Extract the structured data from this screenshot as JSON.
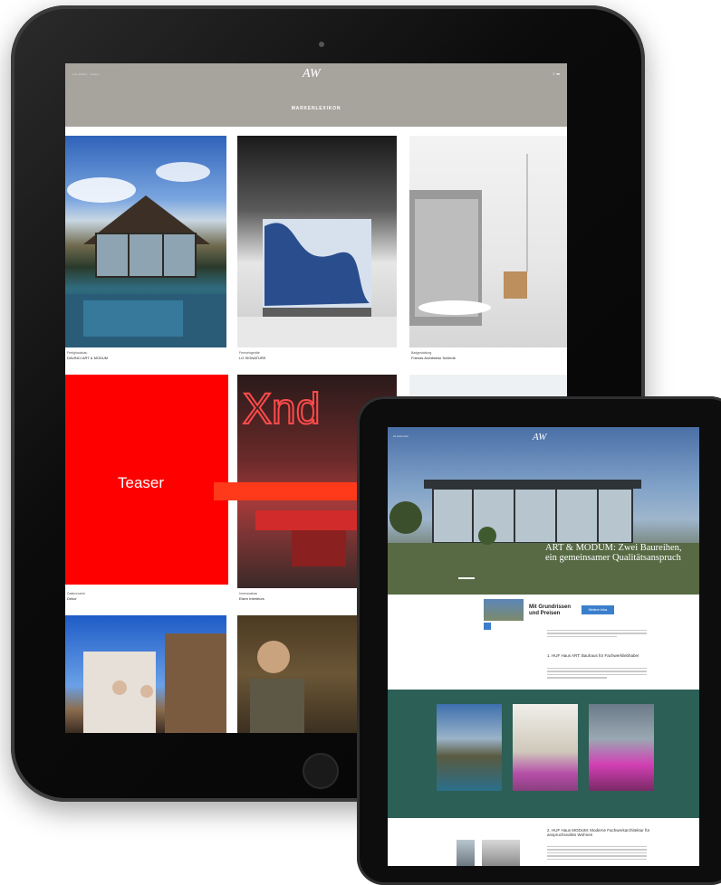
{
  "teaser": {
    "label": "Teaser"
  },
  "back_tablet": {
    "logo": "AW",
    "page_title": "MARKENLEXIKON",
    "tiles": [
      {
        "category": "Fertighausbau",
        "title": "DAVINCI ART & MODUM"
      },
      {
        "category": "Fernsehgeräte",
        "title": "LG SIGNATURE"
      },
      {
        "category": "Badgestaltung",
        "title": "Friends Architektur Schlede"
      },
      {
        "category": "Gastronomie",
        "title": "Dekor"
      },
      {
        "category": "Innenausbau",
        "title": "Eisen Interieurs"
      }
    ]
  },
  "front_tablet": {
    "logo": "AW",
    "hero_headline": "ART & MODUM: Zwei Baureihen, ein gemeinsamer Qualitätsanspruch",
    "promo_title": "Mit Grundrissen und Preisen",
    "promo_button": "Weitere Infos",
    "section1_title": "1. HUF Haus ART: Bauhaus für Fachwerkliebhaber",
    "section2_title": "2. HUF Haus MODUM: Moderne Fachwerkarchitektur für anspruchsvolles Wohnen"
  },
  "colors": {
    "teaser": "#ff0000",
    "arrow": "#ff3a1a",
    "header_taupe": "#a7a49d",
    "green_band": "#2c5f55",
    "promo_button": "#3b7fcc"
  },
  "icons": [
    "arrow-right-icon",
    "search-icon",
    "menu-icon"
  ]
}
